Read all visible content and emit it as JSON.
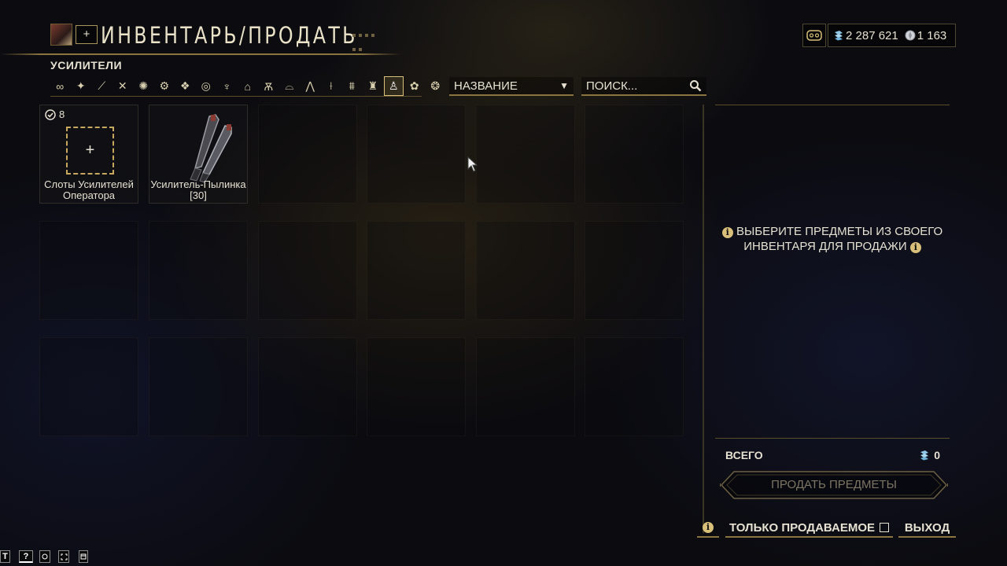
{
  "header": {
    "title": "ИНВЕНТАРЬ/ПРОДАТЬ",
    "add_label": "+"
  },
  "currency": {
    "credits": "2 287 621",
    "platinum": "1 163"
  },
  "category": "УСИЛИТЕЛИ",
  "filter_icons": [
    "all-icon",
    "warframe-icon",
    "primary-weapon-icon",
    "secondary-weapon-icon",
    "melee-icon",
    "sentinel-icon",
    "companion-icon",
    "archwing-icon",
    "mod-icon",
    "relic-icon",
    "arcane-icon",
    "archgun-icon",
    "archmelee-icon",
    "kdrive-icon",
    "zaw-icon",
    "gear-icon",
    "amp-icon",
    "resource-icon",
    "misc-icon"
  ],
  "active_filter_index": 16,
  "sort": {
    "value": "НАЗВАНИЕ"
  },
  "search": {
    "placeholder": "ПОИСК..."
  },
  "items": [
    {
      "label": "Слоты Усилителей Оператора",
      "count": "8"
    },
    {
      "label": "Усилитель-Пылинка [30]"
    }
  ],
  "panel": {
    "message_line1": "ВЫБЕРИТЕ ПРЕДМЕТЫ ИЗ СВОЕГО",
    "message_line2": "ИНВЕНТАРЯ ДЛЯ ПРОДАЖИ",
    "total_label": "ВСЕГО",
    "total_value": "0",
    "sell_label": "ПРОДАТЬ ПРЕДМЕТЫ"
  },
  "bottom": {
    "info": "i",
    "only_sellable": "ТОЛЬКО ПРОДАВАЕМОЕ",
    "exit": "ВЫХОД"
  },
  "hints": [
    "T",
    "?",
    "",
    "",
    ""
  ],
  "colors": {
    "accent_gold": "#d9c07a",
    "border_gold": "#8a7440",
    "text": "#e6e1d2",
    "disabled_text": "#7c7563"
  }
}
